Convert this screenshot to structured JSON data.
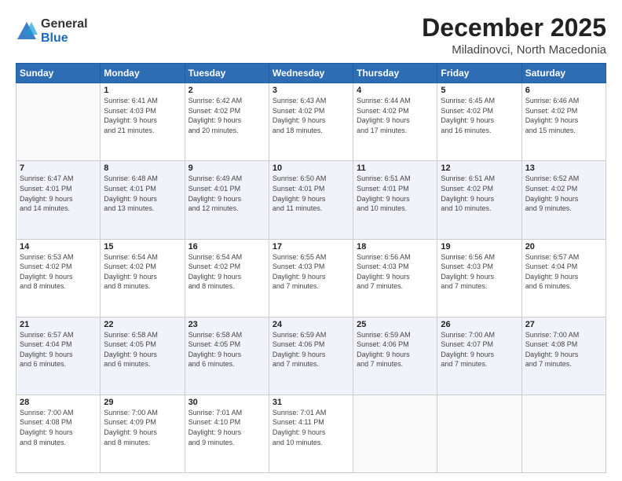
{
  "logo": {
    "general": "General",
    "blue": "Blue"
  },
  "title": {
    "month": "December 2025",
    "location": "Miladinovci, North Macedonia"
  },
  "weekdays": [
    "Sunday",
    "Monday",
    "Tuesday",
    "Wednesday",
    "Thursday",
    "Friday",
    "Saturday"
  ],
  "weeks": [
    [
      {
        "day": "",
        "info": ""
      },
      {
        "day": "1",
        "info": "Sunrise: 6:41 AM\nSunset: 4:03 PM\nDaylight: 9 hours\nand 21 minutes."
      },
      {
        "day": "2",
        "info": "Sunrise: 6:42 AM\nSunset: 4:02 PM\nDaylight: 9 hours\nand 20 minutes."
      },
      {
        "day": "3",
        "info": "Sunrise: 6:43 AM\nSunset: 4:02 PM\nDaylight: 9 hours\nand 18 minutes."
      },
      {
        "day": "4",
        "info": "Sunrise: 6:44 AM\nSunset: 4:02 PM\nDaylight: 9 hours\nand 17 minutes."
      },
      {
        "day": "5",
        "info": "Sunrise: 6:45 AM\nSunset: 4:02 PM\nDaylight: 9 hours\nand 16 minutes."
      },
      {
        "day": "6",
        "info": "Sunrise: 6:46 AM\nSunset: 4:02 PM\nDaylight: 9 hours\nand 15 minutes."
      }
    ],
    [
      {
        "day": "7",
        "info": "Sunrise: 6:47 AM\nSunset: 4:01 PM\nDaylight: 9 hours\nand 14 minutes."
      },
      {
        "day": "8",
        "info": "Sunrise: 6:48 AM\nSunset: 4:01 PM\nDaylight: 9 hours\nand 13 minutes."
      },
      {
        "day": "9",
        "info": "Sunrise: 6:49 AM\nSunset: 4:01 PM\nDaylight: 9 hours\nand 12 minutes."
      },
      {
        "day": "10",
        "info": "Sunrise: 6:50 AM\nSunset: 4:01 PM\nDaylight: 9 hours\nand 11 minutes."
      },
      {
        "day": "11",
        "info": "Sunrise: 6:51 AM\nSunset: 4:01 PM\nDaylight: 9 hours\nand 10 minutes."
      },
      {
        "day": "12",
        "info": "Sunrise: 6:51 AM\nSunset: 4:02 PM\nDaylight: 9 hours\nand 10 minutes."
      },
      {
        "day": "13",
        "info": "Sunrise: 6:52 AM\nSunset: 4:02 PM\nDaylight: 9 hours\nand 9 minutes."
      }
    ],
    [
      {
        "day": "14",
        "info": "Sunrise: 6:53 AM\nSunset: 4:02 PM\nDaylight: 9 hours\nand 8 minutes."
      },
      {
        "day": "15",
        "info": "Sunrise: 6:54 AM\nSunset: 4:02 PM\nDaylight: 9 hours\nand 8 minutes."
      },
      {
        "day": "16",
        "info": "Sunrise: 6:54 AM\nSunset: 4:02 PM\nDaylight: 9 hours\nand 8 minutes."
      },
      {
        "day": "17",
        "info": "Sunrise: 6:55 AM\nSunset: 4:03 PM\nDaylight: 9 hours\nand 7 minutes."
      },
      {
        "day": "18",
        "info": "Sunrise: 6:56 AM\nSunset: 4:03 PM\nDaylight: 9 hours\nand 7 minutes."
      },
      {
        "day": "19",
        "info": "Sunrise: 6:56 AM\nSunset: 4:03 PM\nDaylight: 9 hours\nand 7 minutes."
      },
      {
        "day": "20",
        "info": "Sunrise: 6:57 AM\nSunset: 4:04 PM\nDaylight: 9 hours\nand 6 minutes."
      }
    ],
    [
      {
        "day": "21",
        "info": "Sunrise: 6:57 AM\nSunset: 4:04 PM\nDaylight: 9 hours\nand 6 minutes."
      },
      {
        "day": "22",
        "info": "Sunrise: 6:58 AM\nSunset: 4:05 PM\nDaylight: 9 hours\nand 6 minutes."
      },
      {
        "day": "23",
        "info": "Sunrise: 6:58 AM\nSunset: 4:05 PM\nDaylight: 9 hours\nand 6 minutes."
      },
      {
        "day": "24",
        "info": "Sunrise: 6:59 AM\nSunset: 4:06 PM\nDaylight: 9 hours\nand 7 minutes."
      },
      {
        "day": "25",
        "info": "Sunrise: 6:59 AM\nSunset: 4:06 PM\nDaylight: 9 hours\nand 7 minutes."
      },
      {
        "day": "26",
        "info": "Sunrise: 7:00 AM\nSunset: 4:07 PM\nDaylight: 9 hours\nand 7 minutes."
      },
      {
        "day": "27",
        "info": "Sunrise: 7:00 AM\nSunset: 4:08 PM\nDaylight: 9 hours\nand 7 minutes."
      }
    ],
    [
      {
        "day": "28",
        "info": "Sunrise: 7:00 AM\nSunset: 4:08 PM\nDaylight: 9 hours\nand 8 minutes."
      },
      {
        "day": "29",
        "info": "Sunrise: 7:00 AM\nSunset: 4:09 PM\nDaylight: 9 hours\nand 8 minutes."
      },
      {
        "day": "30",
        "info": "Sunrise: 7:01 AM\nSunset: 4:10 PM\nDaylight: 9 hours\nand 9 minutes."
      },
      {
        "day": "31",
        "info": "Sunrise: 7:01 AM\nSunset: 4:11 PM\nDaylight: 9 hours\nand 10 minutes."
      },
      {
        "day": "",
        "info": ""
      },
      {
        "day": "",
        "info": ""
      },
      {
        "day": "",
        "info": ""
      }
    ]
  ]
}
